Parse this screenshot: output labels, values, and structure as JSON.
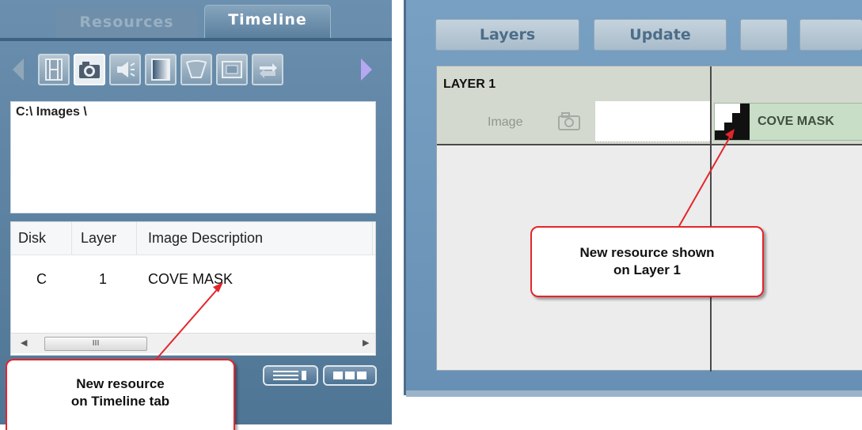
{
  "tabs": [
    {
      "label": "Resources",
      "active": false
    },
    {
      "label": "Timeline",
      "active": true
    }
  ],
  "toolbar": {
    "icons": [
      "film-icon",
      "camera-icon",
      "speaker-icon",
      "gradient-icon",
      "funnel-icon",
      "frame-icon",
      "swap-icon"
    ],
    "active_icon": "camera-icon"
  },
  "folder_path": "C:\\ Images \\",
  "resource_table": {
    "columns": [
      "Disk",
      "Layer",
      "Image Description"
    ],
    "rows": [
      {
        "disk": "C",
        "layer": "1",
        "description": "COVE MASK"
      }
    ],
    "scroll_thumb_label": "III"
  },
  "right_toolbar": {
    "layers_label": "Layers",
    "update_label": "Update"
  },
  "timeline": {
    "layer_title": "LAYER 1",
    "track_label": "Image",
    "clip_label": "COVE MASK"
  },
  "callouts": {
    "right": [
      "New resource shown",
      "on Layer 1"
    ],
    "left": [
      "New resource",
      "on Timeline tab"
    ]
  },
  "colors": {
    "panel_blue": "#5f84a6",
    "callout_border": "#e4252b",
    "clip_green": "#c8dec6"
  }
}
